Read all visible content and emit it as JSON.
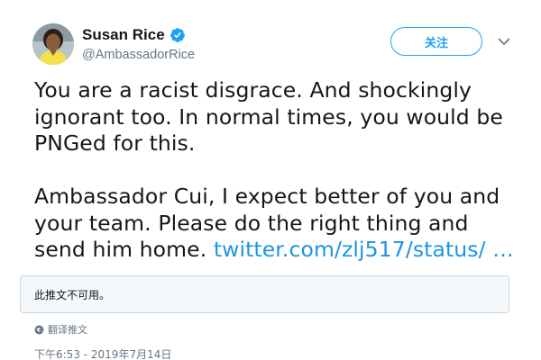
{
  "author": {
    "display_name": "Susan Rice",
    "handle": "@AmbassadorRice",
    "verified": true
  },
  "follow_button": {
    "label": "关注"
  },
  "tweet": {
    "paragraph_1": "You are a racist disgrace. And shockingly ignorant too. In normal times, you would be PNGed for this.",
    "paragraph_2_text": "Ambassador Cui, I expect better of you and your team. Please do the right thing and send him home. ",
    "paragraph_2_link": "twitter.com/zlj517/status/ …"
  },
  "quoted_tweet": {
    "unavailable_text": "此推文不可用。"
  },
  "translate": {
    "label": "翻译推文"
  },
  "timestamp": "下午6:53 - 2019年7月14日",
  "colors": {
    "accent": "#1da1f2",
    "link": "#1b95e0",
    "secondary_text": "#657786",
    "card_border": "#ccd6dd",
    "card_background": "#f5f8fa"
  },
  "icons": {
    "verified": "verified-badge-icon",
    "chevron": "chevron-down-icon",
    "translate": "globe-icon"
  }
}
